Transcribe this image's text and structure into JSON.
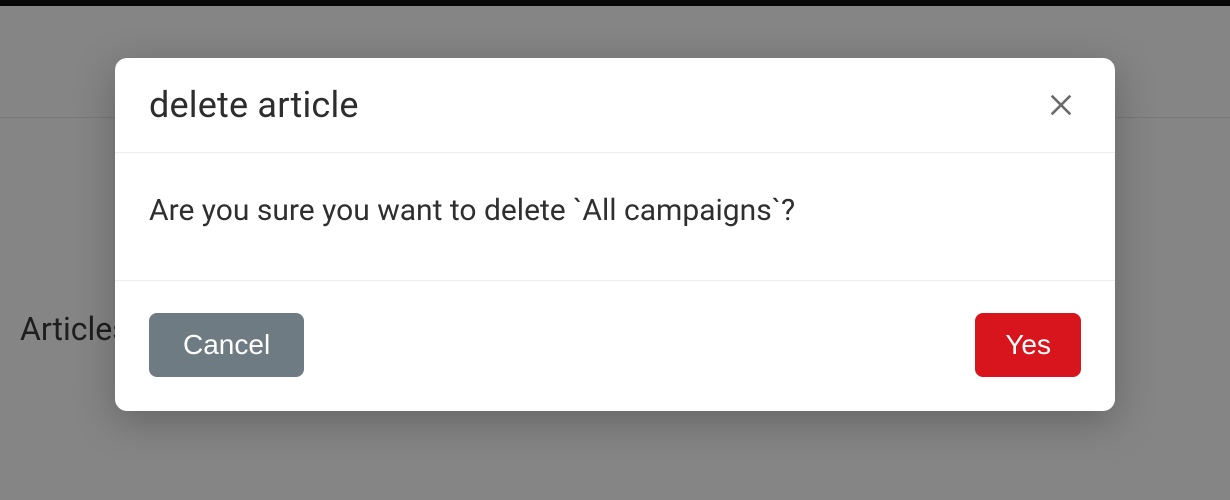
{
  "background": {
    "section_label": "Articles"
  },
  "modal": {
    "title": "delete article",
    "message": "Are you sure you want to delete `All campaigns`?",
    "cancel_label": "Cancel",
    "confirm_label": "Yes"
  }
}
